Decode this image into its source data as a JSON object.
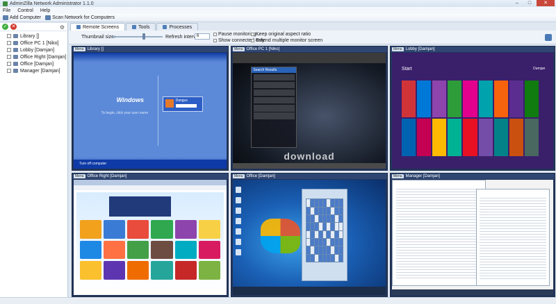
{
  "window": {
    "title": "AdminZilla Network Administrator 1.1.0"
  },
  "menu": [
    "File",
    "Control",
    "Help"
  ],
  "toolbar": {
    "add_computer": "Add Computer",
    "scan_network": "Scan Network for Computers"
  },
  "computers": [
    "Library []",
    "Office PC 1 [Niko]",
    "Lobby [Damjan]",
    "Office Right [Damjan]",
    "Office [Damjan]",
    "Manager [Damjan]"
  ],
  "tabs": [
    "Remote Screens",
    "Tools",
    "Processes"
  ],
  "options": {
    "thumbnail_size_label": "Thumbnail size:",
    "refresh_interval_label": "Refresh interval (s):",
    "refresh_interval_value": "6",
    "thumbnail_size_level": 0.62,
    "pause_monitoring": "Pause monitoring...",
    "show_connected_only": "Show connected only",
    "keep_aspect_ratio": "Keep original aspect ratio",
    "extend_multiple_monitor": "Extend multiple monitor screen"
  },
  "tiles": [
    {
      "menu": "Menu",
      "title": "Library []"
    },
    {
      "menu": "Menu",
      "title": "Office PC 1 [Niko]"
    },
    {
      "menu": "Menu",
      "title": "Lobby [Damjan]"
    },
    {
      "menu": "Menu",
      "title": "Office Right [Damjan]"
    },
    {
      "menu": "Menu",
      "title": "Office [Damjan]"
    },
    {
      "menu": "Menu",
      "title": "Manager [Damjan]"
    }
  ],
  "screens": {
    "library": {
      "logo": "Windows",
      "welcome": "To begin, click your user name",
      "user": "Dangus",
      "bottom": "Turn off computer"
    },
    "office_pc": {
      "panel_title": "Search Results",
      "watermark": "download"
    },
    "lobby": {
      "start": "Start",
      "user": "Damjan"
    }
  },
  "colors": {
    "accent": "#2f4672",
    "w8_tiles": [
      "#d13438",
      "#0078d7",
      "#8e44ad",
      "#2d9d3a",
      "#e3008c",
      "#00a2ad",
      "#f7630c",
      "#5c2d91",
      "#107c10",
      "#0063b1",
      "#c30052",
      "#ffb900",
      "#00b294",
      "#e81123",
      "#744da9",
      "#038387",
      "#ca5010",
      "#486860"
    ],
    "browser_games": [
      "#f2a11c",
      "#3a7bd5",
      "#e94b3c",
      "#2fa84f",
      "#8e44ad",
      "#f7d046",
      "#1e88e5",
      "#ff7043",
      "#43a047",
      "#6d4c41",
      "#00acc1",
      "#d81b60",
      "#fbc02d",
      "#5e35b1",
      "#ef6c00",
      "#26a69a",
      "#c62828",
      "#7cb342"
    ]
  }
}
